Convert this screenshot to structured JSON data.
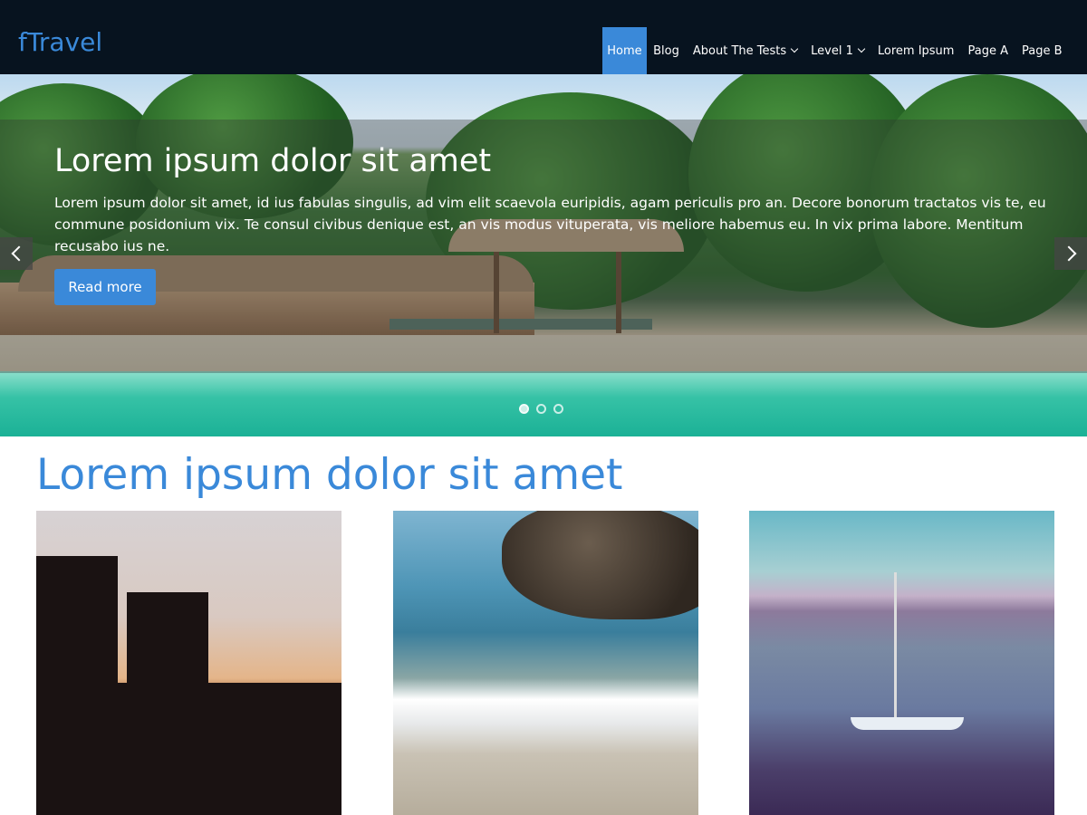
{
  "header": {
    "logo": "fTravel",
    "nav": [
      {
        "label": "Home",
        "active": true,
        "has_dropdown": false
      },
      {
        "label": "Blog",
        "active": false,
        "has_dropdown": false
      },
      {
        "label": "About The Tests",
        "active": false,
        "has_dropdown": true
      },
      {
        "label": "Level 1",
        "active": false,
        "has_dropdown": true
      },
      {
        "label": "Lorem Ipsum",
        "active": false,
        "has_dropdown": false
      },
      {
        "label": "Page A",
        "active": false,
        "has_dropdown": false
      },
      {
        "label": "Page B",
        "active": false,
        "has_dropdown": false
      }
    ]
  },
  "slider": {
    "title": "Lorem ipsum dolor sit amet",
    "text": "Lorem ipsum dolor sit amet, id ius fabulas singulis, ad vim elit scaevola euripidis, agam periculis pro an. Decore bonorum tractatos vis te, eu commune posidonium vix. Te consul civibus denique est, an vis modus vituperata, vis meliore habemus eu. In vix prima labore. Mentitum recusabo ius ne.",
    "button_label": "Read more",
    "slide_count": 3,
    "active_slide": 1,
    "prev_icon": "chevron-left-icon",
    "next_icon": "chevron-right-icon"
  },
  "section": {
    "title": "Lorem ipsum dolor sit amet",
    "images": [
      "castle silhouette at sunset",
      "beach with rocks and waves",
      "sailboat on a lake"
    ]
  },
  "colors": {
    "header_bg": "#07131f",
    "accent": "#3a89d9",
    "text_light": "#ffffff"
  }
}
